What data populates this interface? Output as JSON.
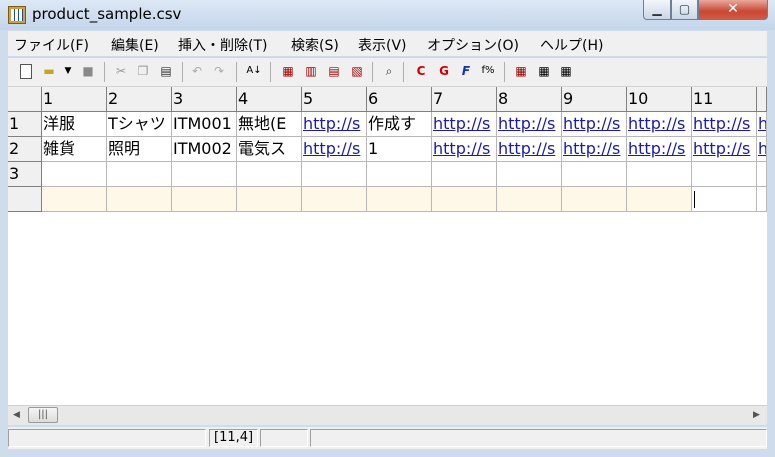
{
  "window": {
    "title": "product_sample.csv"
  },
  "menu": [
    "ファイル(F)",
    "編集(E)",
    "挿入・削除(T)",
    "検索(S)",
    "表示(V)",
    "オプション(O)",
    "ヘルプ(H)"
  ],
  "toolbar_icons": [
    "new-file-icon",
    "open-folder-icon",
    "dropdown-arrow-icon",
    "save-icon",
    "cut-icon",
    "copy-icon",
    "paste-icon",
    "undo-icon",
    "redo-icon",
    "sort-icon",
    "insert-row-icon",
    "insert-column-icon",
    "delete-row-icon",
    "delete-column-icon",
    "find-icon",
    "recalc-icon",
    "recalc-all-icon",
    "function-icon",
    "formula-icon",
    "table-view-icon",
    "table-grid-icon",
    "table-alt-icon"
  ],
  "grid": {
    "column_headers": [
      "1",
      "2",
      "3",
      "4",
      "5",
      "6",
      "7",
      "8",
      "9",
      "10",
      "11"
    ],
    "row_headers": [
      "1",
      "2",
      "3",
      ""
    ],
    "rows": [
      [
        "洋服",
        "Tシャツ",
        "ITM001",
        "無地(E",
        "http://s",
        "作成す",
        "http://s",
        "http://s",
        "http://s",
        "http://s",
        "http://s",
        "h"
      ],
      [
        "雑貨",
        "照明",
        "ITM002",
        "電気ス",
        "http://s",
        "1",
        "http://s",
        "http://s",
        "http://s",
        "http://s",
        "http://s",
        "h"
      ],
      [
        "",
        "",
        "",
        "",
        "",
        "",
        "",
        "",
        "",
        "",
        "",
        ""
      ]
    ],
    "link_columns": [
      4,
      6,
      7,
      8,
      9,
      10,
      11
    ]
  },
  "status": {
    "position": "[11,4]"
  }
}
